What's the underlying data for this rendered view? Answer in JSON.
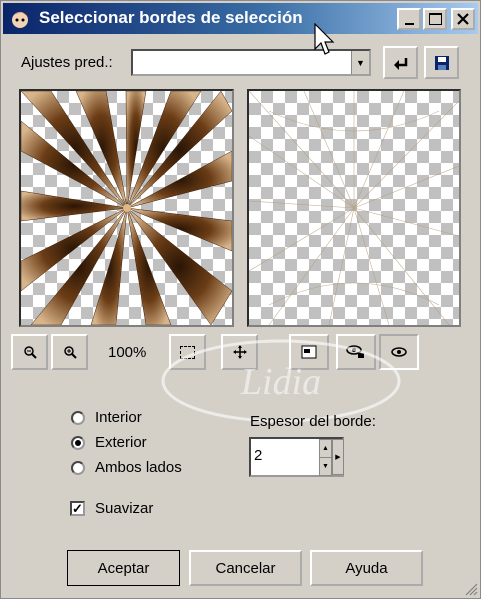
{
  "window": {
    "title": "Seleccionar bordes de selección"
  },
  "presets": {
    "label": "Ajustes pred.:",
    "value": ""
  },
  "zoom": {
    "level": "100%"
  },
  "mode": {
    "options": [
      "Interior",
      "Exterior",
      "Ambos lados"
    ],
    "selected": "Exterior"
  },
  "border": {
    "label": "Espesor del borde:",
    "value": "2"
  },
  "smooth": {
    "label": "Suavizar",
    "checked": true
  },
  "buttons": {
    "ok": "Aceptar",
    "cancel": "Cancelar",
    "help": "Ayuda"
  },
  "watermark": {
    "text": "Lidia"
  },
  "colors": {
    "titlebar_start": "#0a246a",
    "titlebar_end": "#a6caf0",
    "face": "#d4d0c8",
    "preview_brown": "#6b3d16"
  }
}
